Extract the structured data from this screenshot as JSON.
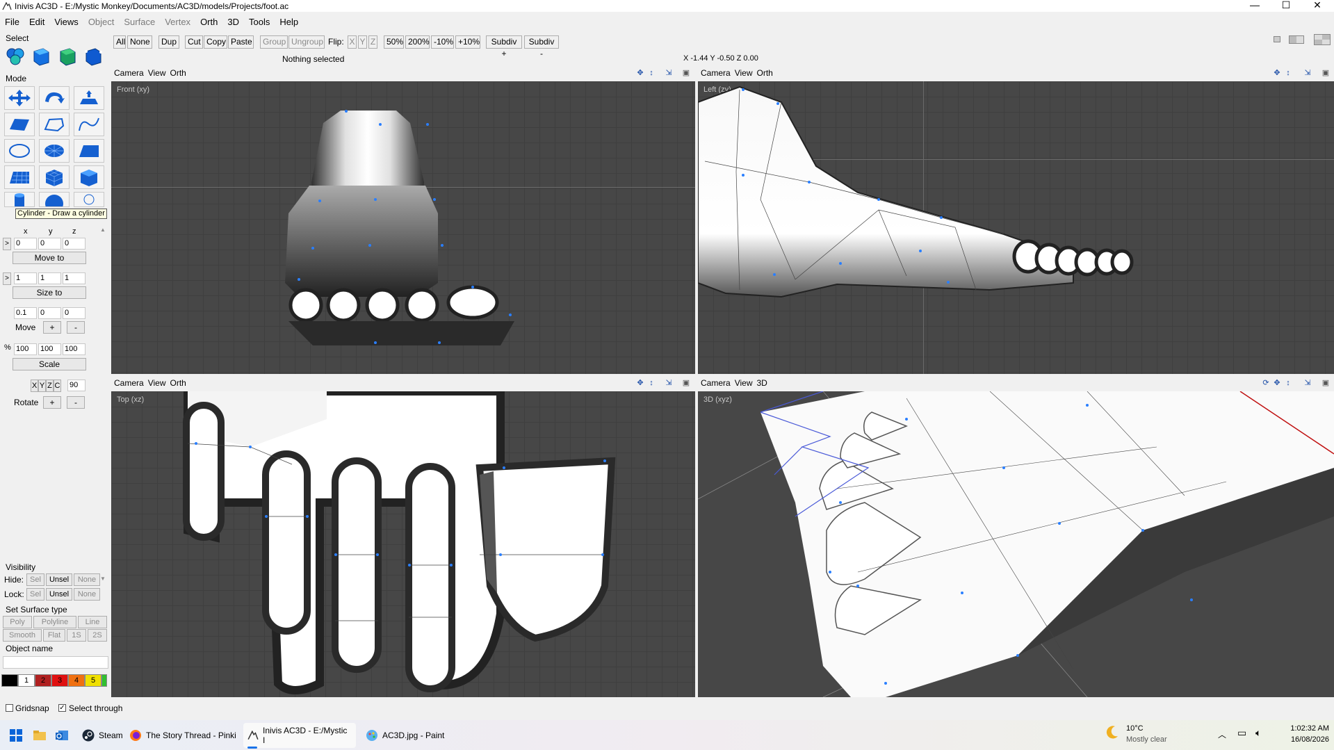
{
  "window": {
    "title": "Inivis AC3D - E:/Mystic Monkey/Documents/AC3D/models/Projects/foot.ac",
    "minimize": "—",
    "maximize": "☐",
    "close": "✕"
  },
  "menu": [
    "File",
    "Edit",
    "Views",
    "Object",
    "Surface",
    "Vertex",
    "Orth",
    "3D",
    "Tools",
    "Help"
  ],
  "menu_disabled": [
    "Object",
    "Surface",
    "Vertex"
  ],
  "toolbar": {
    "all": "All",
    "none": "None",
    "dup": "Dup",
    "cut": "Cut",
    "copy": "Copy",
    "paste": "Paste",
    "group": "Group",
    "ungroup": "Ungroup",
    "flip": "Flip:",
    "flip_x": "X",
    "flip_y": "Y",
    "flip_z": "Z",
    "zoom50": "50%",
    "zoom200": "200%",
    "minus10": "-10%",
    "plus10": "+10%",
    "subdiv_plus": "Subdiv +",
    "subdiv_minus": "Subdiv -",
    "status": "Nothing selected",
    "coords": "X -1.44 Y -0.50 Z 0.00"
  },
  "left": {
    "select_label": "Select",
    "mode_label": "Mode",
    "tooltip": "Cylinder - Draw a cylinder",
    "axis_x": "x",
    "axis_y": "y",
    "axis_z": "z",
    "pos": [
      "0",
      "0",
      "0"
    ],
    "move_to": "Move to",
    "size": [
      "1",
      "1",
      "1"
    ],
    "size_to": "Size to",
    "move_vals": [
      "0.1",
      "0",
      "0"
    ],
    "move": "Move",
    "plus": "+",
    "minus": "-",
    "scale_pct": "%",
    "scale_vals": [
      "100",
      "100",
      "100"
    ],
    "scale": "Scale",
    "rot_axes": [
      "X",
      "Y",
      "Z",
      "C"
    ],
    "rot_angle": "90",
    "rotate": "Rotate",
    "visibility": "Visibility",
    "hide": "Hide:",
    "lock": "Lock:",
    "sel": "Sel",
    "unsel": "Unsel",
    "none": "None",
    "surface_type": "Set Surface type",
    "poly": "Poly",
    "polyline": "Polyline",
    "line": "Line",
    "smooth": "Smooth",
    "flat": "Flat",
    "one_s": "1S",
    "two_s": "2S",
    "object_name": "Object name",
    "colors": [
      {
        "label": "",
        "color": "#000000"
      },
      {
        "label": "1",
        "color": "#ffffff"
      },
      {
        "label": "2",
        "color": "#b02020"
      },
      {
        "label": "3",
        "color": "#e01010"
      },
      {
        "label": "4",
        "color": "#f07010"
      },
      {
        "label": "5",
        "color": "#f0e000"
      },
      {
        "label": "",
        "color": "#30c030"
      }
    ],
    "gridsnap": "Gridsnap",
    "select_through": "Select through"
  },
  "viewports": [
    {
      "head": [
        "Camera",
        "View",
        "Orth"
      ],
      "label": "Front (xy)"
    },
    {
      "head": [
        "Camera",
        "View",
        "Orth"
      ],
      "label": "Left (zy)"
    },
    {
      "head": [
        "Camera",
        "View",
        "Orth"
      ],
      "label": "Top (xz)"
    },
    {
      "head": [
        "Camera",
        "View",
        "3D"
      ],
      "label": "3D (xyz)"
    }
  ],
  "taskbar": {
    "steam": "Steam",
    "firefox": "The Story Thread - Pinki",
    "ac3d": "Inivis AC3D - E:/Mystic I",
    "paint": "AC3D.jpg - Paint",
    "temp": "10°C",
    "weather": "Mostly clear",
    "time": "1:02:32 AM",
    "date": "16/08/2026"
  }
}
